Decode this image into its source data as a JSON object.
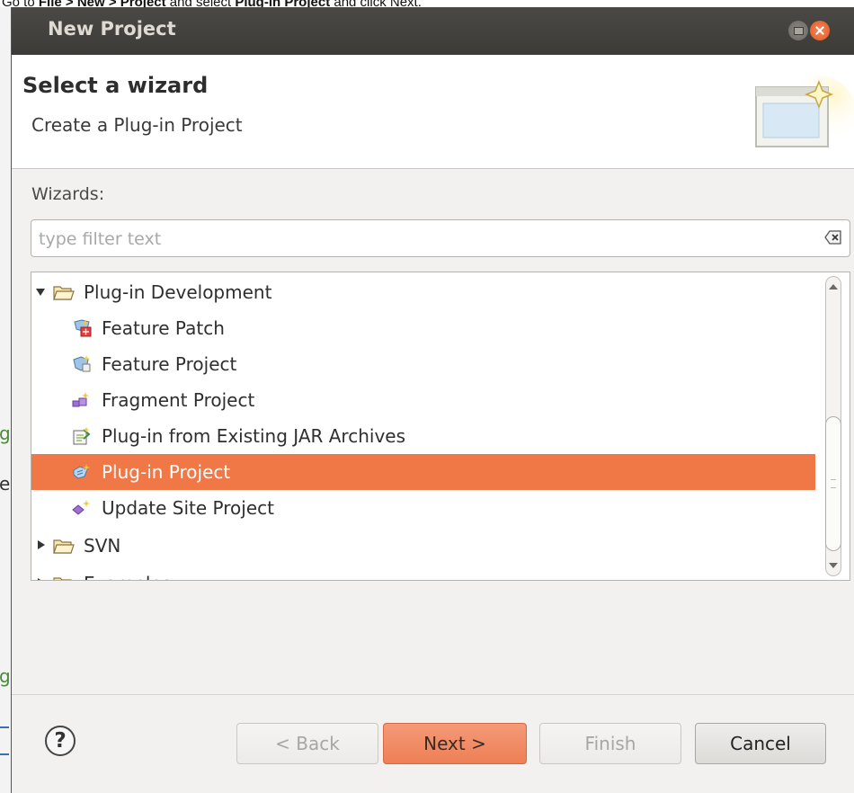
{
  "instruction": {
    "prefix": "Go to ",
    "file": "File",
    "sep1": " > ",
    "new": "New",
    "sep2": " > ",
    "project": "Project",
    "mid": " and select ",
    "plugin_project": "Plug-in Project",
    "suffix": " and click Next."
  },
  "window": {
    "title": "New Project"
  },
  "header": {
    "title": "Select a wizard",
    "description": "Create a Plug-in Project"
  },
  "wizards_label": "Wizards:",
  "filter": {
    "placeholder": "type filter text",
    "value": ""
  },
  "tree": {
    "items": [
      {
        "label": "Plug-in Development",
        "icon": "folder-open-icon",
        "expanded": true,
        "level": 0
      },
      {
        "label": "Feature Patch",
        "icon": "feature-patch-icon",
        "level": 1
      },
      {
        "label": "Feature Project",
        "icon": "feature-project-icon",
        "level": 1
      },
      {
        "label": "Fragment Project",
        "icon": "fragment-project-icon",
        "level": 1
      },
      {
        "label": "Plug-in from Existing JAR Archives",
        "icon": "plugin-jar-icon",
        "level": 1
      },
      {
        "label": "Plug-in Project",
        "icon": "plugin-project-icon",
        "level": 1,
        "selected": true
      },
      {
        "label": "Update Site Project",
        "icon": "update-site-icon",
        "level": 1
      },
      {
        "label": "SVN",
        "icon": "folder-icon",
        "expanded": false,
        "level": 0
      },
      {
        "label": "Examples",
        "icon": "folder-icon",
        "expanded": false,
        "level": 0
      }
    ]
  },
  "buttons": {
    "help": "?",
    "back": "< Back",
    "next": "Next >",
    "finish": "Finish",
    "cancel": "Cancel"
  },
  "colors": {
    "selection": "#f07746",
    "titlebar": "#3c3b37"
  }
}
